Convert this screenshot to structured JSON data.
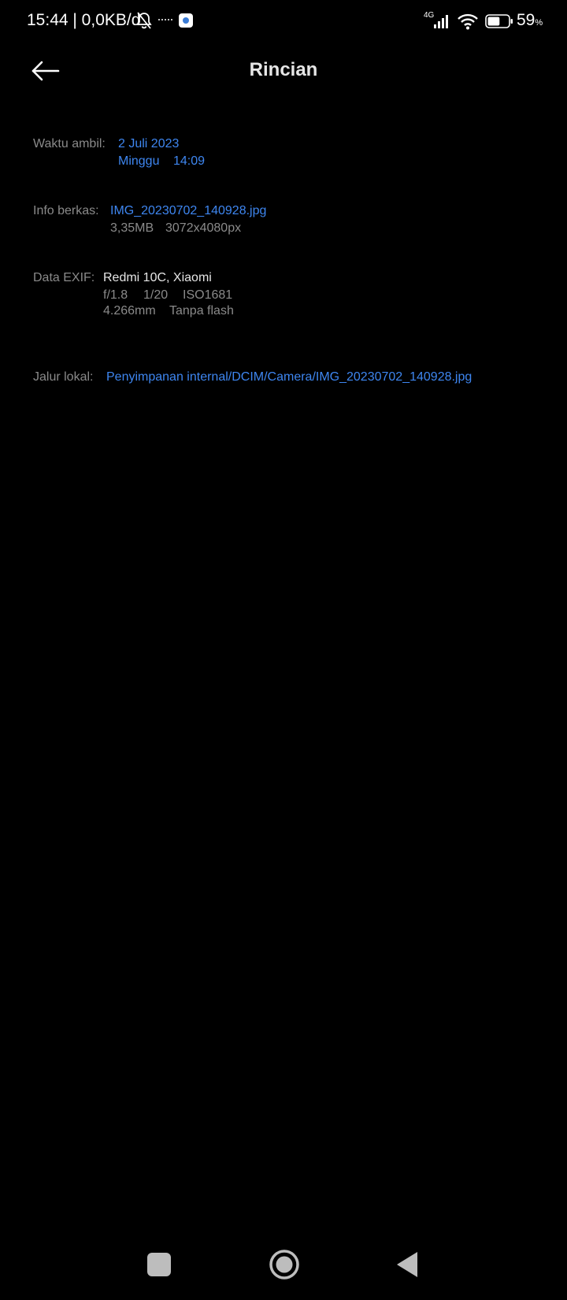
{
  "status_bar": {
    "time_and_speed": "15:44 | 0,0KB/d",
    "network_type": "4G",
    "battery_percent": "59",
    "battery_unit": "%",
    "battery_level": 0.59,
    "icons": [
      "bell-off-icon",
      "app-notification-icon",
      "signal-icon",
      "wifi-icon",
      "battery-icon"
    ]
  },
  "header": {
    "title": "Rincian",
    "back_icon": "arrow-left-icon"
  },
  "details": {
    "taken_time": {
      "label": "Waktu ambil:",
      "date": "2 Juli 2023",
      "day": "Minggu",
      "time": "14:09"
    },
    "file_info": {
      "label": "Info berkas:",
      "filename": "IMG_20230702_140928.jpg",
      "size": "3,35MB",
      "resolution": "3072x4080px"
    },
    "exif": {
      "label": "Data EXIF:",
      "device": "Redmi 10C, Xiaomi",
      "aperture": "f/1.8",
      "shutter": "1/20",
      "iso": "ISO1681",
      "focal_length": "4.266mm",
      "flash": "Tanpa flash"
    },
    "local_path": {
      "label": "Jalur lokal:",
      "path": "Penyimpanan internal/DCIM/Camera/IMG_20230702_140928.jpg"
    }
  },
  "colors": {
    "background": "#000000",
    "accent": "#3e86f0",
    "label": "#8a8a8a",
    "text": "#e6e6e6"
  },
  "nav_bar": {
    "icons": [
      "recent-apps-icon",
      "home-icon",
      "back-triangle-icon"
    ]
  }
}
